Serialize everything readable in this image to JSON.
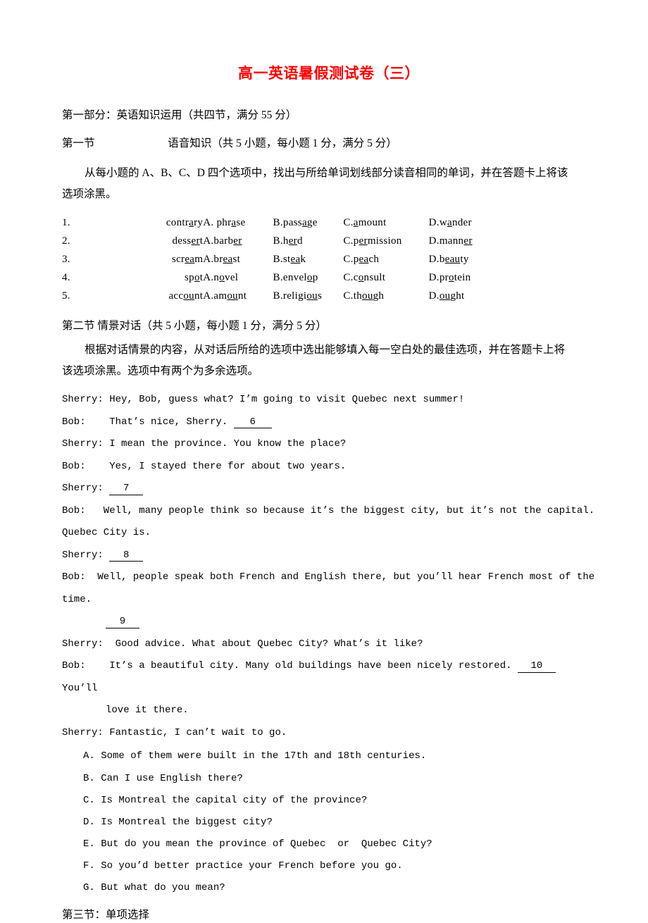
{
  "document": {
    "title": "高一英语暑假测试卷（三）",
    "title_color": "#FF0000"
  },
  "part1": {
    "heading": "第一部分：英语知识运用（共四节，满分 55 分）"
  },
  "section1": {
    "label": "第一节",
    "heading": "语音知识（共 5 小题，每小题 1 分，满分 5 分）",
    "instruction_line1": "从每小题的 A、B、C、D 四个选项中，找出与所给单词划线部分读音相同的单词，并在答题卡上将该",
    "instruction_line2": "选项涂黑。",
    "questions": [
      {
        "num": "1.",
        "stem_pre": "contr",
        "stem_u": "a",
        "stem_post": "ry",
        "options": [
          {
            "letter": "A.",
            "pre": " phr",
            "u": "a",
            "post": "se"
          },
          {
            "letter": "B.",
            "pre": "pass",
            "u": "a",
            "post": "ge"
          },
          {
            "letter": "C.",
            "pre": "",
            "u": "a",
            "post": "mount"
          },
          {
            "letter": "D.",
            "pre": "w",
            "u": "a",
            "post": "nder"
          }
        ]
      },
      {
        "num": "2.",
        "stem_pre": "dess",
        "stem_u": "er",
        "stem_post": "t",
        "options": [
          {
            "letter": "A.",
            "pre": "barb",
            "u": "er",
            "post": ""
          },
          {
            "letter": "B.",
            "pre": "h",
            "u": "er",
            "post": "d"
          },
          {
            "letter": "C.",
            "pre": "p",
            "u": "er",
            "post": "mission"
          },
          {
            "letter": "D.",
            "pre": "mann",
            "u": "er",
            "post": ""
          }
        ]
      },
      {
        "num": "3.",
        "stem_pre": "scr",
        "stem_u": "ea",
        "stem_post": "m",
        "options": [
          {
            "letter": "A.",
            "pre": "br",
            "u": "ea",
            "post": "st"
          },
          {
            "letter": "B.",
            "pre": "st",
            "u": "ea",
            "post": "k"
          },
          {
            "letter": "C.",
            "pre": "p",
            "u": "ea",
            "post": "ch"
          },
          {
            "letter": "D.",
            "pre": "b",
            "u": "eau",
            "post": "ty"
          }
        ]
      },
      {
        "num": "4.",
        "stem_pre": "sp",
        "stem_u": "o",
        "stem_post": "t",
        "options": [
          {
            "letter": "A.",
            "pre": "n",
            "u": "o",
            "post": "vel"
          },
          {
            "letter": "B.",
            "pre": "envel",
            "u": "o",
            "post": "p"
          },
          {
            "letter": "C.",
            "pre": "c",
            "u": "o",
            "post": "nsult"
          },
          {
            "letter": "D.",
            "pre": "pr",
            "u": "o",
            "post": "tein"
          }
        ]
      },
      {
        "num": "5.",
        "stem_pre": "acc",
        "stem_u": "ou",
        "stem_post": "nt",
        "options": [
          {
            "letter": "A.",
            "pre": "am",
            "u": "ou",
            "post": "nt"
          },
          {
            "letter": "B.",
            "pre": "religi",
            "u": "ou",
            "post": "s"
          },
          {
            "letter": "C.",
            "pre": "th",
            "u": "ou",
            "post": "gh"
          },
          {
            "letter": "D.",
            "pre": "",
            "u": "ou",
            "post": "ght"
          }
        ]
      }
    ]
  },
  "section2": {
    "heading": "第二节 情景对话（共 5 小题，每小题 1 分，满分 5 分）",
    "instruction_line1": "根据对话情景的内容，从对话后所给的选项中选出能够填入每一空白处的最佳选项，并在答题卡上将",
    "instruction_line2": "该选项涂黑。选项中有两个为多余选项。",
    "dialogue": {
      "l1": "Sherry: Hey, Bob, guess what? I’m going to visit Quebec next summer!",
      "l2_speaker": "Bob:    That’s nice, Sherry. ",
      "l2_blank": "6",
      "l3": "Sherry: I mean the province. You know the place?",
      "l4": "Bob:    Yes, I stayed there for about two years.",
      "l5_speaker": "Sherry: ",
      "l5_blank": "7",
      "l6": "Bob:   Well, many people think so because it’s the biggest city, but it’s not the capital.",
      "l7": "Quebec City is.",
      "l8_speaker": "Sherry: ",
      "l8_blank": "8",
      "l9": "Bob:  Well, people speak both French and English there, but you’ll hear French most of the time.",
      "l10_blank": "9",
      "l11": "Sherry:  Good advice. What about Quebec City? What’s it like?",
      "l12_speaker": "Bob:    It’s a beautiful city. Many old buildings have been nicely restored. ",
      "l12_blank": "10",
      "l12_tail": " You’ll",
      "l13": "love it there.",
      "l14": "Sherry: Fantastic, I can’t wait to go."
    },
    "options": [
      "A. Some of them were built in the 17th and 18th centuries.",
      "B. Can I use English there?",
      "C. Is Montreal the capital city of the province?",
      "D. Is Montreal the biggest city?",
      "E. But do you mean the province of Quebec  or  Quebec City?",
      "F. So you’d better practice your French before you go.",
      "G. But what do you mean?"
    ]
  },
  "section3": {
    "heading": "第三节：单项选择"
  }
}
